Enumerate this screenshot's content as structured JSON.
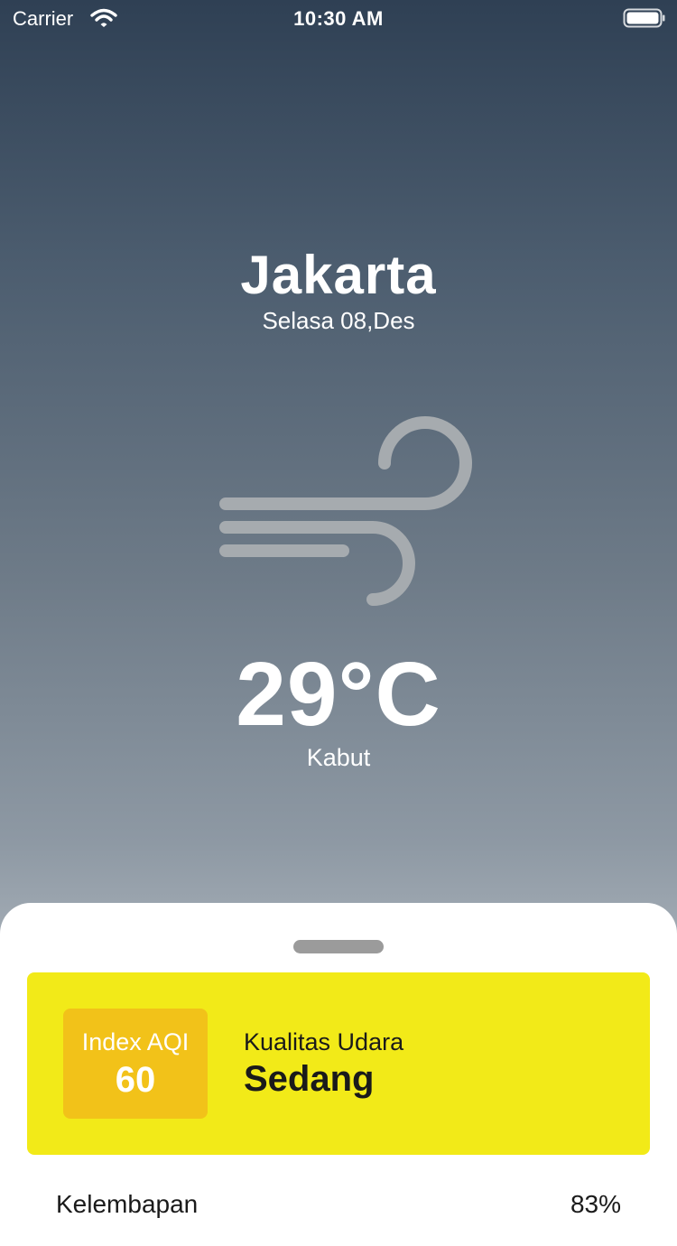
{
  "status_bar": {
    "carrier": "Carrier",
    "time": "10:30 AM",
    "wifi_icon": "wifi-icon",
    "battery_icon": "battery-full-icon"
  },
  "location": {
    "city": "Jakarta",
    "date": "Selasa 08,Des"
  },
  "weather": {
    "icon": "wind-icon",
    "temperature": "29°C",
    "condition": "Kabut"
  },
  "air_quality": {
    "index_label": "Index AQI",
    "index_value": "60",
    "quality_label": "Kualitas Udara",
    "quality_value": "Sedang",
    "card_color": "#f2ea18",
    "badge_color": "#f2c219"
  },
  "details": [
    {
      "label": "Kelembapan",
      "value": "83%"
    }
  ]
}
